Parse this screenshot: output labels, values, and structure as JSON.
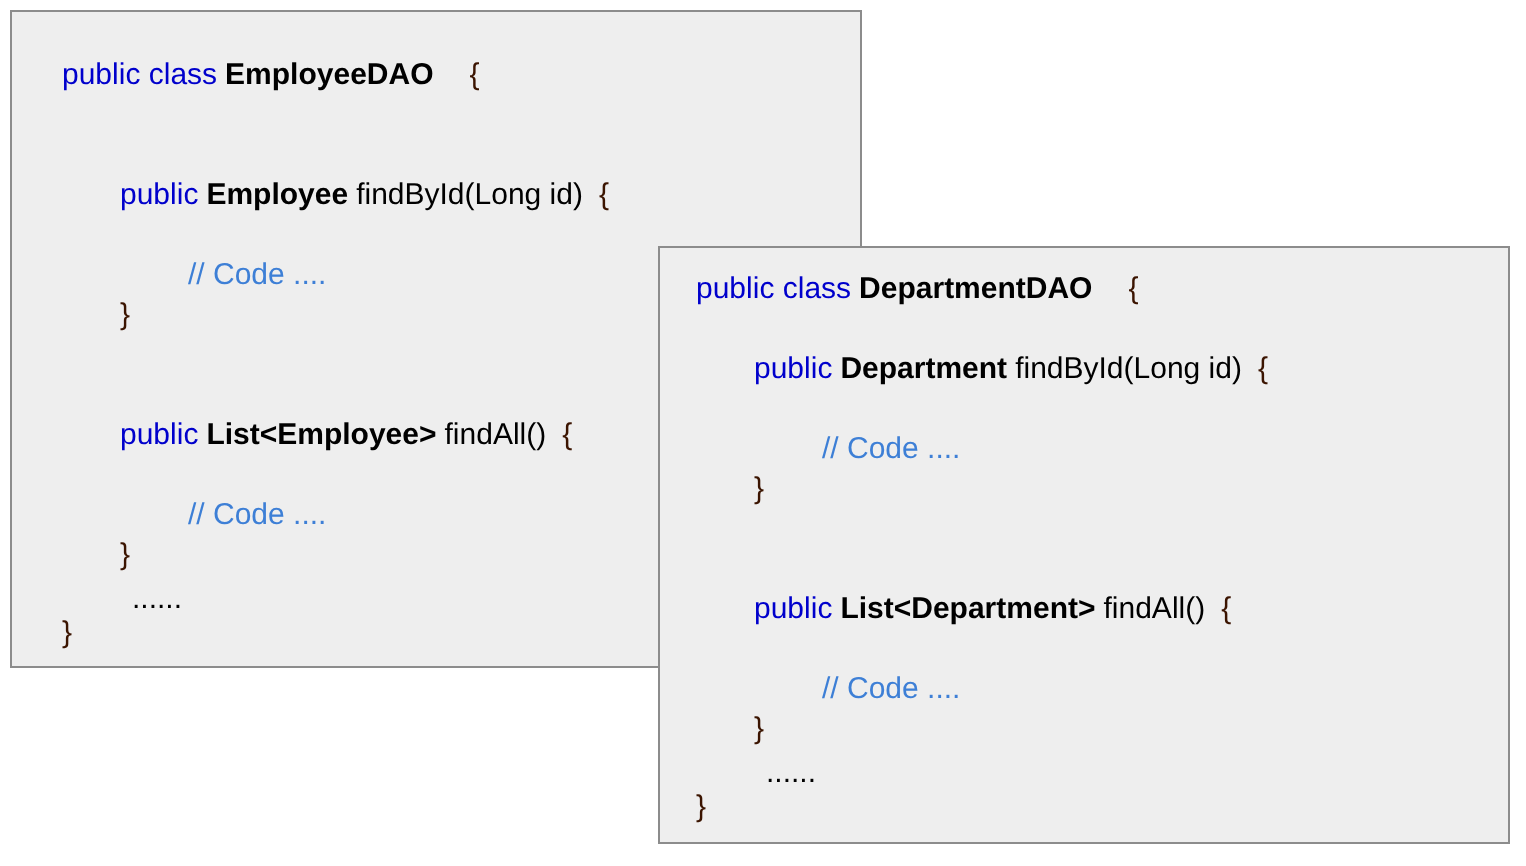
{
  "panels": [
    {
      "lines": [
        {
          "kind": "class",
          "parts": [
            {
              "kind": "keyword",
              "text": "public class"
            },
            {
              "kind": "name",
              "text": "EmployeeDAO"
            },
            {
              "kind": "brace",
              "text": "{"
            }
          ]
        },
        {
          "kind": "method",
          "parts": [
            {
              "kind": "keyword",
              "text": "public"
            },
            {
              "kind": "name",
              "text": "Employee"
            },
            {
              "kind": "plain",
              "text": "findById(Long id)"
            },
            {
              "kind": "brace",
              "text": "{"
            }
          ]
        },
        {
          "kind": "comment",
          "parts": [
            {
              "kind": "comment",
              "text": "// Code ...."
            }
          ]
        },
        {
          "kind": "end",
          "parts": [
            {
              "kind": "brace",
              "text": "}"
            }
          ]
        },
        {
          "kind": "method",
          "parts": [
            {
              "kind": "keyword",
              "text": "public"
            },
            {
              "kind": "name",
              "text": "List<Employee>"
            },
            {
              "kind": "plain",
              "text": "findAll()"
            },
            {
              "kind": "brace",
              "text": "{"
            }
          ]
        },
        {
          "kind": "comment",
          "parts": [
            {
              "kind": "comment",
              "text": "// Code ...."
            }
          ]
        },
        {
          "kind": "end",
          "parts": [
            {
              "kind": "brace",
              "text": "}"
            }
          ]
        },
        {
          "kind": "more",
          "parts": [
            {
              "kind": "plain",
              "text": "......"
            }
          ]
        },
        {
          "kind": "close",
          "parts": [
            {
              "kind": "brace",
              "text": "}"
            }
          ]
        }
      ]
    },
    {
      "lines": [
        {
          "kind": "class",
          "parts": [
            {
              "kind": "keyword",
              "text": "public class"
            },
            {
              "kind": "name",
              "text": "DepartmentDAO"
            },
            {
              "kind": "brace",
              "text": "{"
            }
          ]
        },
        {
          "kind": "method",
          "parts": [
            {
              "kind": "keyword",
              "text": "public"
            },
            {
              "kind": "name",
              "text": "Department"
            },
            {
              "kind": "plain",
              "text": "findById(Long id)"
            },
            {
              "kind": "brace",
              "text": "{"
            }
          ]
        },
        {
          "kind": "comment",
          "parts": [
            {
              "kind": "comment",
              "text": "// Code ...."
            }
          ]
        },
        {
          "kind": "end",
          "parts": [
            {
              "kind": "brace",
              "text": "}"
            }
          ]
        },
        {
          "kind": "method",
          "parts": [
            {
              "kind": "keyword",
              "text": "public"
            },
            {
              "kind": "name",
              "text": "List<Department>"
            },
            {
              "kind": "plain",
              "text": "findAll()"
            },
            {
              "kind": "brace",
              "text": "{"
            }
          ]
        },
        {
          "kind": "comment",
          "parts": [
            {
              "kind": "comment",
              "text": "// Code ...."
            }
          ]
        },
        {
          "kind": "end",
          "parts": [
            {
              "kind": "brace",
              "text": "}"
            }
          ]
        },
        {
          "kind": "more",
          "parts": [
            {
              "kind": "plain",
              "text": "......"
            }
          ]
        },
        {
          "kind": "close",
          "parts": [
            {
              "kind": "brace",
              "text": "}"
            }
          ]
        }
      ]
    }
  ]
}
